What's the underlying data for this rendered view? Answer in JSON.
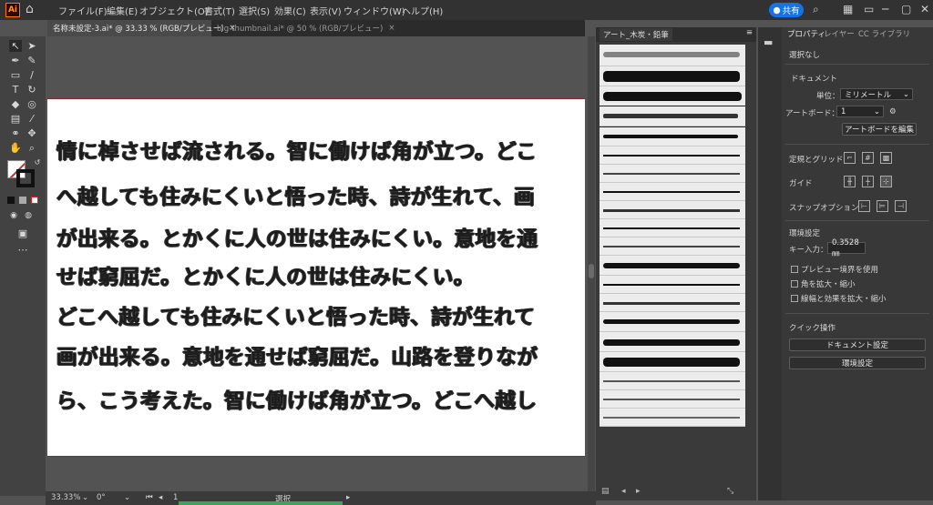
{
  "app": {
    "logo": "Ai",
    "home_icon": "home-icon"
  },
  "menu": [
    "ファイル(F)",
    "編集(E)",
    "オブジェクト(O)",
    "書式(T)",
    "選択(S)",
    "効果(C)",
    "表示(V)",
    "ウィンドウ(W)",
    "ヘルプ(H)"
  ],
  "topbar": {
    "share_label": "共有",
    "share_icon": "user-icon",
    "search_icon": "search-icon",
    "arrange_icon": "arrange-icon",
    "window_controls": [
      "─",
      "▢",
      "✕"
    ]
  },
  "tabs": [
    {
      "label": "名称未設定-3.ai* @ 33.33 % (RGB/プレビュー)",
      "close": "×",
      "active": true
    },
    {
      "label": "big-thumbnail.ai* @ 50 % (RGB/プレビュー)",
      "close": "×",
      "active": false
    }
  ],
  "artboard_text": [
    "情に棹させば流される。智に働けば角が立つ。どこ",
    "へ越しても住みにくいと悟った時、詩が生れて、画",
    "が出来る。とかくに人の世は住みにくい。意地を通",
    "せば窮屈だ。とかくに人の世は住みにくい。",
    "どこへ越しても住みにくいと悟った時、詩が生れて",
    "画が出来る。意地を通せば窮屈だ。山路を登りなが",
    "ら、こう考えた。智に働けば角が立つ。どこへ越し"
  ],
  "brush_panel": {
    "title": "アート_木炭・鉛筆",
    "menu_icon": "≡",
    "footer_icons": [
      "folder-icon",
      "prev-icon",
      "next-icon",
      "delete-icon"
    ]
  },
  "properties": {
    "tabs": [
      "プロパティ",
      "レイヤー",
      "CC ライブラリ"
    ],
    "selection": "選択なし",
    "document_title": "ドキュメント",
    "unit_label": "単位：",
    "unit_value": "ミリメートル",
    "artboard_label": "アートボード：",
    "artboard_value": "1",
    "artboard_edit": "アートボードを編集",
    "rulers_grid": "定規とグリッド",
    "guides": "ガイド",
    "snap_options": "スナップオプション",
    "preferences_title": "環境設定",
    "key_input_label": "キー入力：",
    "key_input_value": "0.3528 ㎜",
    "checks": [
      "プレビュー境界を使用",
      "角を拡大・縮小",
      "線幅と効果を拡大・縮小"
    ],
    "quick_actions": "クイック操作",
    "doc_settings_btn": "ドキュメント設定",
    "pref_btn": "環境設定"
  },
  "status": {
    "zoom": "33.33%",
    "rotate": "0°",
    "page": "1",
    "tool": "選択"
  },
  "colors": {
    "accent": "#1473e6",
    "artboard": "#ffffff",
    "panel": "#383838",
    "green": "#3fa15a"
  }
}
